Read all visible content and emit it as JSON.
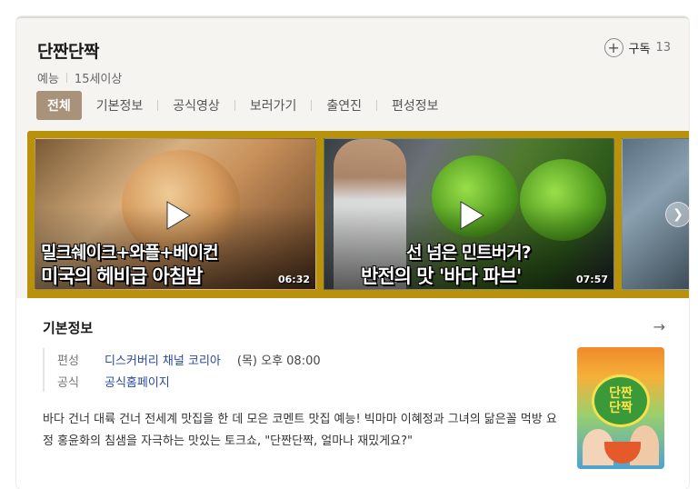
{
  "program": {
    "title": "단짠단짝",
    "genre": "예능",
    "rating": "15세이상"
  },
  "subscribe": {
    "label": "구독",
    "count": "13",
    "icon": "plus-circle-icon"
  },
  "tabs": [
    {
      "label": "전체",
      "active": true
    },
    {
      "label": "기본정보",
      "active": false
    },
    {
      "label": "공식영상",
      "active": false
    },
    {
      "label": "보러가기",
      "active": false
    },
    {
      "label": "출연진",
      "active": false
    },
    {
      "label": "편성정보",
      "active": false
    }
  ],
  "clips": [
    {
      "caption_line1": "밀크쉐이크+와플+베이컨",
      "caption_line2": "미국의 헤비급 아침밥",
      "duration": "06:32"
    },
    {
      "caption_line1": "선 넘은 민트버거?",
      "caption_line2": "반전의 맛 '바다 파브'",
      "duration": "07:57"
    }
  ],
  "info": {
    "section_title": "기본정보",
    "schedule_label": "편성",
    "channel": "디스커버리 채널 코리아",
    "airtime": "(목) 오후 08:00",
    "official_label": "공식",
    "homepage": "공식홈페이지",
    "description": "바다 건너 대륙 건너 전세계 맛집을 한 데 모은 코멘트 맛집 예능! 빅마마 이혜정과 그녀의 닮은꼴 먹방 요정 홍윤화의 침샘을 자극하는 맛있는 토크쇼, \"단짠단짝, 얼마나 재밌게요?\"",
    "poster_title_line1": "단짠",
    "poster_title_line2": "단짝"
  },
  "colors": {
    "active_tab": "#a8927a",
    "clip_strip": "#b8920a",
    "link": "#2a4a9a"
  }
}
